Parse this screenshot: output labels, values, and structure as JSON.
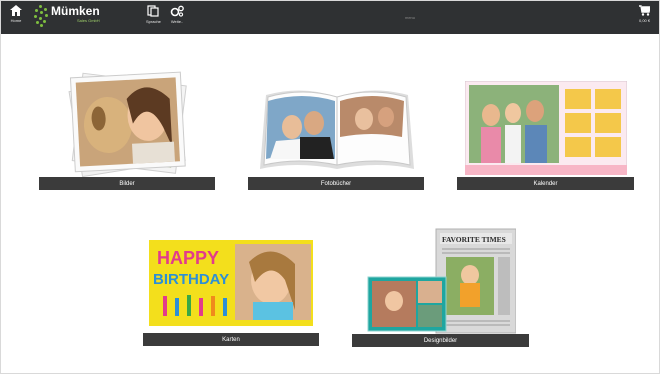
{
  "header": {
    "home_label": "Home",
    "brand_name": "Mümken",
    "brand_sub": "Sales GmbH",
    "language_label": "Sprache",
    "more_label": "Weite..",
    "center_text": "menu",
    "cart_label": "0,00 €"
  },
  "tiles": {
    "bilder": "Bilder",
    "fotobuecher": "Fotobücher",
    "kalender": "Kalender",
    "karten": "Karten",
    "designbilder": "Designbilder"
  },
  "artwork": {
    "card_text_1": "HAPPY",
    "card_text_2": "BIRTHDAY",
    "newspaper_title": "FAVORITE TIMES"
  },
  "colors": {
    "topbar": "#2f3133",
    "tile_bar": "#3b3b3b",
    "brand_green": "#7fbf3f",
    "card_yellow": "#f3df1c"
  }
}
